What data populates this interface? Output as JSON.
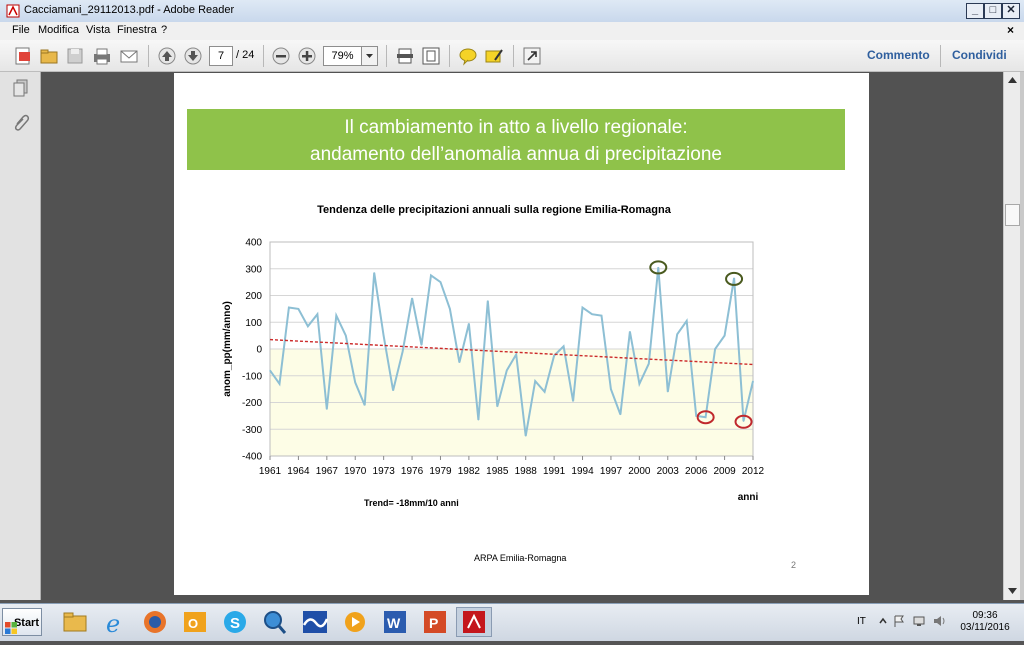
{
  "window": {
    "title": "Cacciamani_29112013.pdf - Adobe Reader",
    "controls": {
      "minimize": "_",
      "maximize": "□",
      "close": "✕"
    }
  },
  "menu": {
    "items": [
      "File",
      "Modifica",
      "Vista",
      "Finestra",
      "?"
    ],
    "close_doc": "×"
  },
  "toolbar": {
    "page_current": "7",
    "page_total": "/ 24",
    "zoom": "79%",
    "comment_label": "Commento",
    "share_label": "Condividi"
  },
  "slide": {
    "banner_line1": "Il cambiamento in atto a livello regionale:",
    "banner_line2": "andamento dell’anomalia annua di precipitazione",
    "trend_note": "Trend= -18mm/10 anni",
    "footer": "ARPA Emilia-Romagna",
    "page_number": "2"
  },
  "chart_data": {
    "type": "line",
    "title": "Tendenza  delle precipitazioni annuali sulla regione Emilia-Romagna",
    "xlabel": "anni",
    "ylabel": "anom_pp(mm/anno)",
    "ylim": [
      -400,
      400
    ],
    "yticks": [
      400,
      300,
      200,
      100,
      0,
      -100,
      -200,
      -300,
      -400
    ],
    "xticks": [
      1961,
      1964,
      1967,
      1970,
      1973,
      1976,
      1979,
      1982,
      1985,
      1988,
      1991,
      1994,
      1997,
      2000,
      2003,
      2006,
      2009,
      2012
    ],
    "grid": "horizontal",
    "series": [
      {
        "color": "#8dbfd4",
        "x": [
          1961,
          1962,
          1963,
          1964,
          1965,
          1966,
          1967,
          1968,
          1969,
          1970,
          1971,
          1972,
          1973,
          1974,
          1975,
          1976,
          1977,
          1978,
          1979,
          1980,
          1981,
          1982,
          1983,
          1984,
          1985,
          1986,
          1987,
          1988,
          1989,
          1990,
          1991,
          1992,
          1993,
          1994,
          1995,
          1996,
          1997,
          1998,
          1999,
          2000,
          2001,
          2002,
          2003,
          2004,
          2005,
          2006,
          2007,
          2008,
          2009,
          2010,
          2011,
          2012
        ],
        "values": [
          -80,
          -130,
          155,
          150,
          85,
          130,
          -225,
          125,
          50,
          -125,
          -210,
          285,
          50,
          -155,
          -10,
          190,
          15,
          275,
          250,
          150,
          -50,
          95,
          -265,
          180,
          -215,
          -80,
          -20,
          -325,
          -120,
          -160,
          -25,
          10,
          -195,
          155,
          130,
          125,
          -150,
          -245,
          65,
          -130,
          -55,
          305,
          -160,
          55,
          105,
          -250,
          -255,
          0,
          50,
          265,
          -270,
          -120
        ]
      },
      {
        "type": "trendline",
        "color": "#cc2a2a",
        "x": [
          1961,
          2012
        ],
        "values": [
          35,
          -58
        ]
      }
    ],
    "annotations": [
      {
        "type": "circle",
        "x": 2002,
        "y": 305,
        "color": "#4a5a1f"
      },
      {
        "type": "circle",
        "x": 2010,
        "y": 262,
        "color": "#4a5a1f"
      },
      {
        "type": "circle",
        "x": 2007,
        "y": -255,
        "color": "#c0282d"
      },
      {
        "type": "circle",
        "x": 2011,
        "y": -272,
        "color": "#c0282d"
      }
    ]
  },
  "taskbar": {
    "start_label": "Start",
    "apps": [
      "file-explorer-icon",
      "internet-explorer-icon",
      "firefox-icon",
      "outlook-icon",
      "skype-icon",
      "search-app-icon",
      "wave-app-icon",
      "media-player-icon",
      "word-icon",
      "powerpoint-icon",
      "acrobat-icon"
    ],
    "language": "IT",
    "time": "09:36",
    "date": "03/11/2016"
  }
}
